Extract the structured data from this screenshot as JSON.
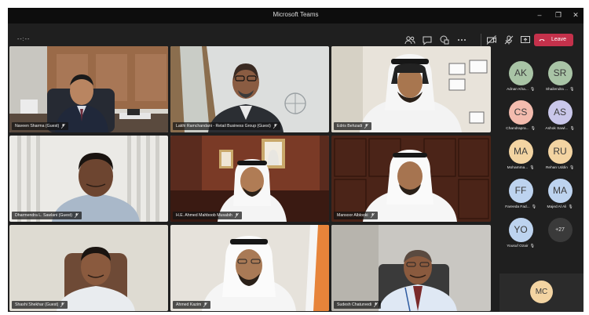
{
  "window": {
    "title": "Microsoft Teams"
  },
  "toolbar": {
    "timer": "--:--",
    "leave_label": "Leave"
  },
  "tiles": [
    {
      "name": "Naveen Sharma (Guest)"
    },
    {
      "name": "Lakhi Ramchandani - Retail Business Group (Guest)"
    },
    {
      "name": "Edris Behzadi"
    },
    {
      "name": "Dharmendra L. Sawlani (Guest)"
    },
    {
      "name": "H.E. Ahmed Mahboob Musabih"
    },
    {
      "name": "Mansoor Alblooki"
    },
    {
      "name": "Shashi Shekhar (Guest)"
    },
    {
      "name": "Ahmed Kazim"
    },
    {
      "name": "Sudesh Chaturvedi"
    }
  ],
  "roster": {
    "people": [
      {
        "initials": "AK",
        "name": "Adnan Kha...",
        "color": "#a9c4a6"
      },
      {
        "initials": "SR",
        "name": "Shailendra ...",
        "color": "#a9c4a6"
      },
      {
        "initials": "CS",
        "name": "Chandrapra...",
        "color": "#f3bcae"
      },
      {
        "initials": "AS",
        "name": "Ashok Sawl...",
        "color": "#c9c7ea"
      },
      {
        "initials": "MA",
        "name": "Mohamma...",
        "color": "#f3d4a2"
      },
      {
        "initials": "RU",
        "name": "Rehan Uddin",
        "color": "#f3d4a2"
      },
      {
        "initials": "FF",
        "name": "Fareeda Fad...",
        "color": "#bdd3ef"
      },
      {
        "initials": "MA",
        "name": "Majed Al Ali",
        "color": "#bdd3ef"
      },
      {
        "initials": "YO",
        "name": "Yousuf Ozair",
        "color": "#bdd3ef"
      }
    ],
    "more_label": "+27",
    "self": {
      "initials": "MC",
      "color": "#f3d4a2"
    }
  }
}
